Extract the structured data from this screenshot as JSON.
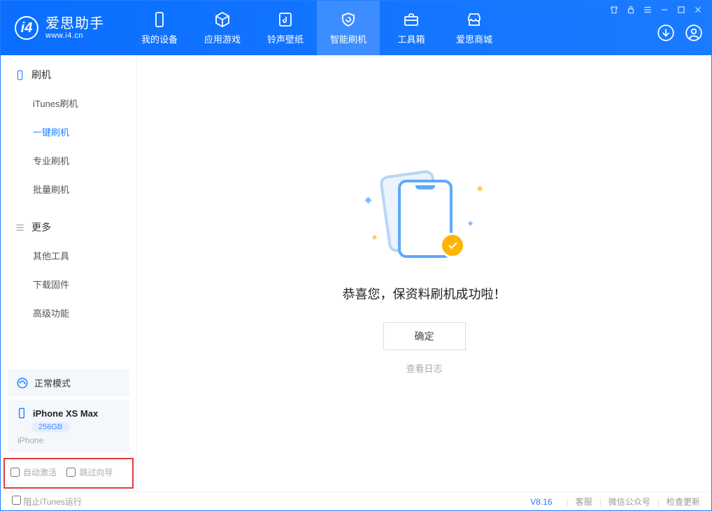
{
  "logo": {
    "glyph": "i4",
    "zh": "爱思助手",
    "url": "www.i4.cn"
  },
  "tabs": {
    "device": "我的设备",
    "apps": "应用游戏",
    "ringtones": "铃声壁纸",
    "flash": "智能刷机",
    "tools": "工具箱",
    "store": "爱思商城"
  },
  "sidebar": {
    "flash_head": "刷机",
    "items": {
      "itunes": "iTunes刷机",
      "onekey": "一键刷机",
      "pro": "专业刷机",
      "batch": "批量刷机"
    },
    "more_head": "更多",
    "more": {
      "other": "其他工具",
      "firmware": "下载固件",
      "advanced": "高级功能"
    }
  },
  "mode": {
    "label": "正常模式"
  },
  "device": {
    "name": "iPhone XS Max",
    "storage": "256GB",
    "type": "iPhone"
  },
  "checks": {
    "auto_activate": "自动激活",
    "skip_guide": "跳过向导"
  },
  "main": {
    "message": "恭喜您，保资料刷机成功啦！",
    "ok": "确定",
    "view_log": "查看日志"
  },
  "footer": {
    "block_itunes": "阻止iTunes运行",
    "version": "V8.16",
    "service": "客服",
    "wechat": "微信公众号",
    "update": "检查更新"
  }
}
